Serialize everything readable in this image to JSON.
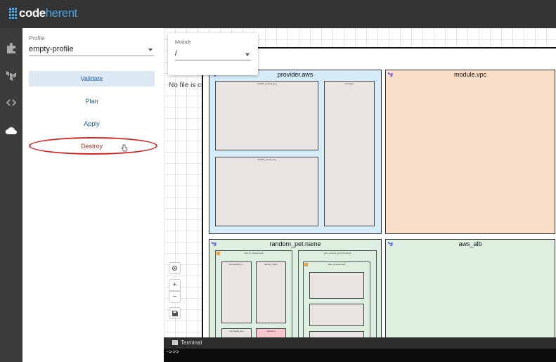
{
  "app": {
    "logo_primary": "code",
    "logo_secondary": "herent"
  },
  "leftnav": {
    "icons": [
      "puzzle-icon",
      "terraform-icon",
      "code-icon",
      "cloud-icon"
    ]
  },
  "profile": {
    "label": "Profile",
    "value": "empty-profile"
  },
  "actions": {
    "validate": "Validate",
    "plan": "Plan",
    "apply": "Apply",
    "destroy": "Destroy"
  },
  "module": {
    "label": "Module",
    "value": "/"
  },
  "canvas": {
    "no_file": "No file is currently selected.",
    "boxes": {
      "provider": "provider.aws",
      "vpc": "module.vpc",
      "random_pet": "random_pet.name",
      "alb": "aws_alb"
    },
    "inner_labels": {
      "access_key": "variable_access_key",
      "secret_key": "variable_secret_key",
      "region": "var.region",
      "listener": "aws_lb_listener.web",
      "sg": "aws_security_group.frontend",
      "instance": "aws_instance.web",
      "a1": "var.instance_p...",
      "a2": "var.key_name",
      "a3": "var.private_key",
      "a4": "outputs.ip"
    },
    "colors": {
      "provider_bg": "#d6ecf8",
      "vpc_bg": "#f9ddc6",
      "random_bg": "#dcefe0",
      "alb_bg": "#dcefe0",
      "accent": "#4aa3df",
      "destroy": "#c62828"
    }
  },
  "terminal": {
    "label": "Terminal",
    "prompt": "~>>>"
  }
}
